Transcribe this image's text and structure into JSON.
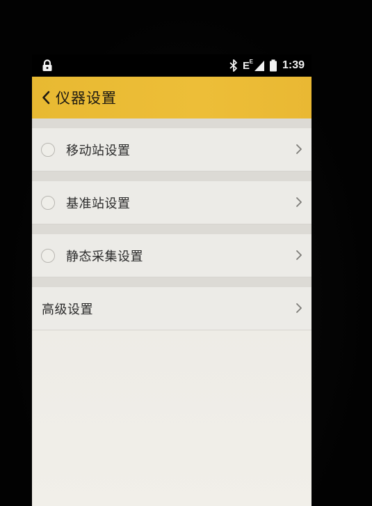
{
  "status_bar": {
    "network_type": "E",
    "network_sup": "E",
    "time": "1:39",
    "icons": [
      "lock-icon",
      "bluetooth-icon",
      "signal-icon",
      "battery-icon"
    ]
  },
  "app_bar": {
    "title": "仪器设置",
    "back_icon": "chevron-left-icon",
    "background": "#ecbc36"
  },
  "settings": {
    "items": [
      {
        "label": "移动站设置",
        "has_radio": true,
        "selected": false
      },
      {
        "label": "基准站设置",
        "has_radio": true,
        "selected": false
      },
      {
        "label": "静态采集设置",
        "has_radio": true,
        "selected": false
      },
      {
        "label": "高级设置",
        "has_radio": false
      }
    ]
  }
}
